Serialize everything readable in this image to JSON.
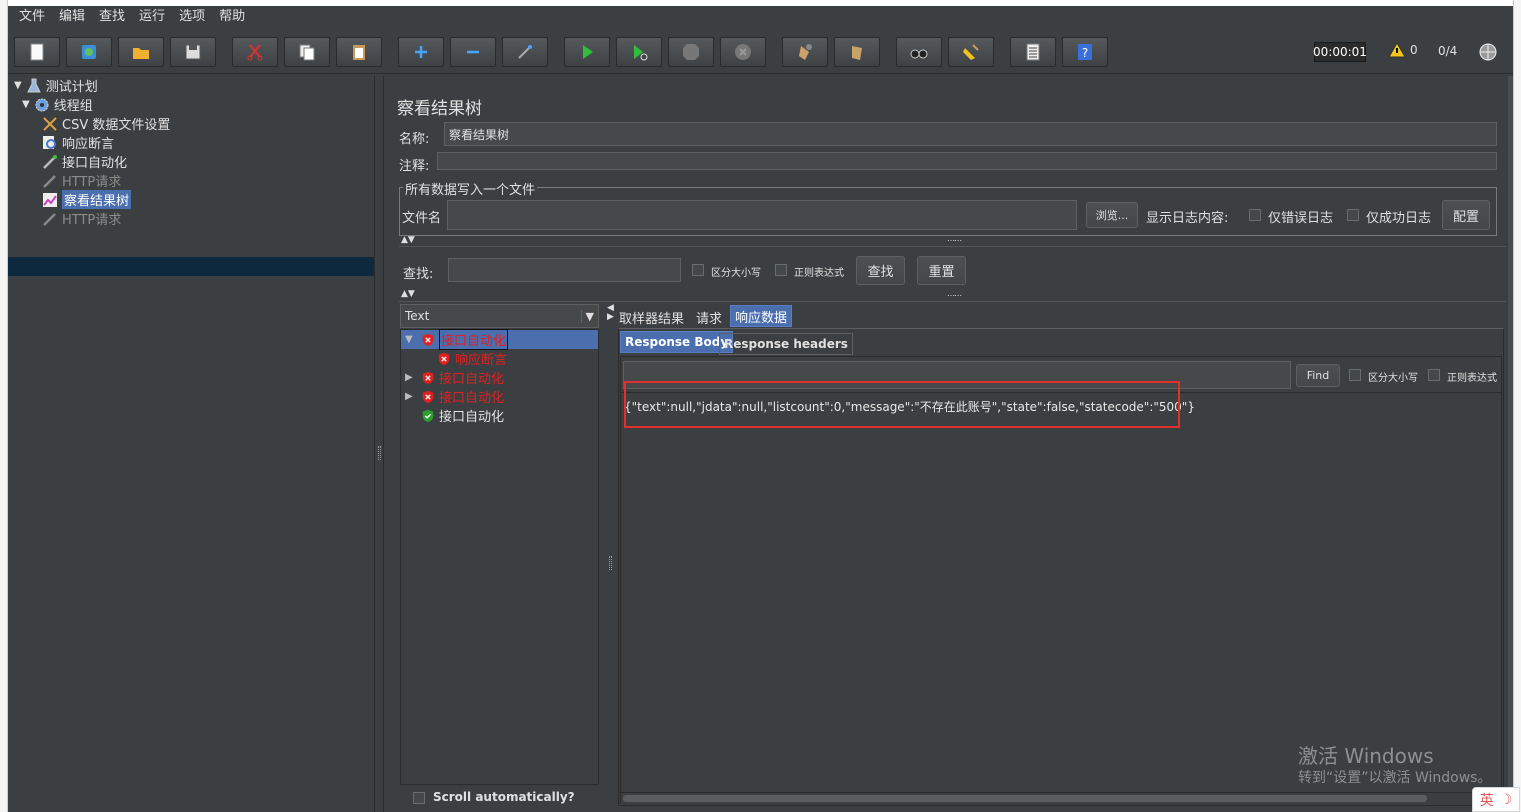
{
  "menu": [
    "文件",
    "编辑",
    "查找",
    "运行",
    "选项",
    "帮助"
  ],
  "toolbar": {
    "buttons": [
      "new",
      "templates",
      "open",
      "save",
      "cut",
      "copy",
      "paste",
      "expand",
      "collapse",
      "toggle",
      "start",
      "start-no-pause",
      "stop",
      "shutdown",
      "clear",
      "clear-all",
      "search",
      "reset-search",
      "function-helper",
      "help"
    ],
    "timer": "00:00:01",
    "warnings": "0",
    "threads": "0/4"
  },
  "tree": {
    "items": [
      {
        "label": "测试计划",
        "icon": "flask-icon"
      },
      {
        "label": "线程组",
        "icon": "gear-icon"
      },
      {
        "label": "CSV 数据文件设置",
        "icon": "tools-icon"
      },
      {
        "label": "响应断言",
        "icon": "magnifier-icon"
      },
      {
        "label": "接口自动化",
        "icon": "pipette-icon"
      },
      {
        "label": "HTTP请求",
        "icon": "pipette-icon"
      },
      {
        "label": "察看结果树",
        "icon": "chart-icon"
      },
      {
        "label": "HTTP请求",
        "icon": "pipette-icon"
      }
    ]
  },
  "panel": {
    "title": "察看结果树",
    "name_label": "名称:",
    "name_value": "察看结果树",
    "comment_label": "注释:",
    "comment_value": "",
    "file_section_title": "所有数据写入一个文件",
    "filename_label": "文件名",
    "filename_value": "",
    "browse_button": "浏览...",
    "log_label": "显示日志内容:",
    "errors_only": "仅错误日志",
    "success_only": "仅成功日志",
    "configure_button": "配置"
  },
  "search": {
    "label": "查找:",
    "value": "",
    "case_sensitive": "区分大小写",
    "regex": "正则表达式",
    "find_button": "查找",
    "reset_button": "重置"
  },
  "renderer": {
    "selected": "Text"
  },
  "results": [
    {
      "label": "接口自动化",
      "status": "error",
      "expanded": true,
      "indent": 0,
      "selected": true
    },
    {
      "label": "响应断言",
      "status": "error",
      "expanded": false,
      "indent": 1,
      "selected": false
    },
    {
      "label": "接口自动化",
      "status": "error",
      "expanded": false,
      "indent": 0,
      "selected": false
    },
    {
      "label": "接口自动化",
      "status": "error",
      "expanded": false,
      "indent": 0,
      "selected": false
    },
    {
      "label": "接口自动化",
      "status": "success",
      "expanded": false,
      "indent": 0,
      "selected": false
    }
  ],
  "scroll_auto": "Scroll automatically?",
  "tabs": [
    "取样器结果",
    "请求",
    "响应数据"
  ],
  "subtabs": [
    "Response Body",
    "Response headers"
  ],
  "response": {
    "find_button": "Find",
    "case_sensitive": "区分大小写",
    "regex": "正则表达式",
    "body": "{\"text\":null,\"jdata\":null,\"listcount\":0,\"message\":\"不存在此账号\",\"state\":false,\"statecode\":\"500\"}"
  },
  "watermark": {
    "line1": "激活 Windows",
    "line2": "转到“设置”以激活 Windows。"
  },
  "ime": {
    "label": "英"
  },
  "colors": {
    "background": "#3c3f41",
    "selection": "#0d293e",
    "error_text": "#e02020",
    "active_tab": "#4b6eaf",
    "highlight": "#e03030"
  }
}
